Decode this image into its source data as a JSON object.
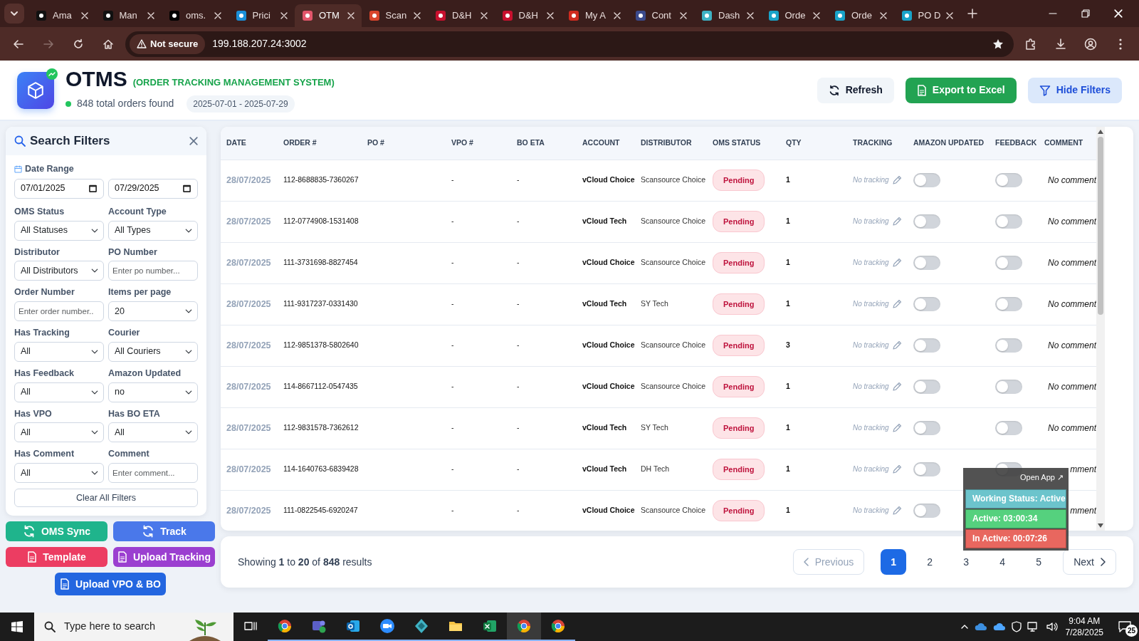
{
  "browser": {
    "tabs": [
      {
        "title": "Ama",
        "selected": false,
        "color": "#111111"
      },
      {
        "title": "Man",
        "selected": false,
        "color": "#111111"
      },
      {
        "title": "oms.",
        "selected": false,
        "color": "#000000"
      },
      {
        "title": "Prici",
        "selected": false,
        "color": "#1a8fd8"
      },
      {
        "title": "OTM",
        "selected": true,
        "color": "#e2566b"
      },
      {
        "title": "Scan",
        "selected": false,
        "color": "#d9452b"
      },
      {
        "title": "D&H",
        "selected": false,
        "color": "#c8102e"
      },
      {
        "title": "D&H",
        "selected": false,
        "color": "#c8102e"
      },
      {
        "title": "My A",
        "selected": false,
        "color": "#d02b1f"
      },
      {
        "title": "Cont",
        "selected": false,
        "color": "#3b4a8c"
      },
      {
        "title": "Dash",
        "selected": false,
        "color": "#3fb2c4"
      },
      {
        "title": "Orde",
        "selected": false,
        "color": "#19a3c9"
      },
      {
        "title": "Orde",
        "selected": false,
        "color": "#19a3c9"
      },
      {
        "title": "PO D",
        "selected": false,
        "color": "#19a3c9"
      }
    ],
    "security": "Not secure",
    "url": "199.188.207.24:3002"
  },
  "header": {
    "title": "OTMS",
    "subtitle": "(ORDER TRACKING MANAGEMENT SYSTEM)",
    "total": "848 total orders found",
    "date_range": "2025-07-01 - 2025-07-29",
    "buttons": [
      {
        "label": "Refresh",
        "kind": "refresh"
      },
      {
        "label": "Export to Excel",
        "kind": "export"
      },
      {
        "label": "Hide Filters",
        "kind": "filter"
      }
    ]
  },
  "filters": {
    "title": "Search Filters",
    "date_range": {
      "label": "Date Range",
      "from": "07/01/2025",
      "to": "07/29/2025"
    },
    "fields": [
      {
        "label": "OMS Status",
        "kind": "select",
        "value": "All Statuses"
      },
      {
        "label": "Account Type",
        "kind": "select",
        "value": "All Types"
      },
      {
        "label": "Distributor",
        "kind": "select",
        "value": "All Distributors"
      },
      {
        "label": "PO Number",
        "kind": "text",
        "placeholder": "Enter po number..."
      },
      {
        "label": "Order Number",
        "kind": "text",
        "placeholder": "Enter order number.."
      },
      {
        "label": "Items per page",
        "kind": "select",
        "value": "20"
      },
      {
        "label": "Has Tracking",
        "kind": "select",
        "value": "All"
      },
      {
        "label": "Courier",
        "kind": "select",
        "value": "All Couriers"
      },
      {
        "label": "Has Feedback",
        "kind": "select",
        "value": "All"
      },
      {
        "label": "Amazon Updated",
        "kind": "select",
        "value": "no"
      },
      {
        "label": "Has VPO",
        "kind": "select",
        "value": "All"
      },
      {
        "label": "Has BO ETA",
        "kind": "select",
        "value": "All"
      },
      {
        "label": "Has Comment",
        "kind": "select",
        "value": "All"
      },
      {
        "label": "Comment",
        "kind": "text",
        "placeholder": "Enter comment..."
      }
    ],
    "clear_button": "Clear All Filters"
  },
  "actions": [
    {
      "label": "OMS Sync",
      "kind": "sync",
      "color": "#1fb48c"
    },
    {
      "label": "Track",
      "kind": "sync",
      "color": "#4a78ea"
    },
    {
      "label": "Template",
      "kind": "file",
      "color": "#ec3d62"
    },
    {
      "label": "Upload Tracking",
      "kind": "file",
      "color": "#9b3fd0"
    },
    {
      "label": "Upload VPO & BO",
      "kind": "file",
      "color": "#2366e0"
    }
  ],
  "table": {
    "columns": [
      "DATE",
      "ORDER #",
      "PO #",
      "VPO #",
      "BO ETA",
      "ACCOUNT",
      "DISTRIBUTOR",
      "OMS STATUS",
      "QTY",
      "TRACKING",
      "AMAZON UPDATED",
      "FEEDBACK",
      "COMMENT"
    ],
    "rows": [
      {
        "date": "28/07/2025",
        "order": "112-8688835-7360267",
        "vpo": "-",
        "bo_eta": "-",
        "account": "vCloud Choice",
        "distributor": "Scansource Choice",
        "status": "Pending",
        "qty": "1",
        "tracking": "No tracking",
        "amazon_updated": false,
        "feedback": false,
        "comment": "No comment"
      },
      {
        "date": "28/07/2025",
        "order": "112-0774908-1531408",
        "vpo": "-",
        "bo_eta": "-",
        "account": "vCloud Tech",
        "distributor": "Scansource Choice",
        "status": "Pending",
        "qty": "1",
        "tracking": "No tracking",
        "amazon_updated": false,
        "feedback": false,
        "comment": "No comment"
      },
      {
        "date": "28/07/2025",
        "order": "111-3731698-8827454",
        "vpo": "-",
        "bo_eta": "-",
        "account": "vCloud Choice",
        "distributor": "Scansource Choice",
        "status": "Pending",
        "qty": "1",
        "tracking": "No tracking",
        "amazon_updated": false,
        "feedback": false,
        "comment": "No comment"
      },
      {
        "date": "28/07/2025",
        "order": "111-9317237-0331430",
        "vpo": "-",
        "bo_eta": "-",
        "account": "vCloud Tech",
        "distributor": "SY Tech",
        "status": "Pending",
        "qty": "1",
        "tracking": "No tracking",
        "amazon_updated": false,
        "feedback": false,
        "comment": "No comment"
      },
      {
        "date": "28/07/2025",
        "order": "112-9851378-5802640",
        "vpo": "-",
        "bo_eta": "-",
        "account": "vCloud Choice",
        "distributor": "Scansource Choice",
        "status": "Pending",
        "qty": "3",
        "tracking": "No tracking",
        "amazon_updated": false,
        "feedback": false,
        "comment": "No comment"
      },
      {
        "date": "28/07/2025",
        "order": "114-8667112-0547435",
        "vpo": "-",
        "bo_eta": "-",
        "account": "vCloud Choice",
        "distributor": "Scansource Choice",
        "status": "Pending",
        "qty": "1",
        "tracking": "No tracking",
        "amazon_updated": false,
        "feedback": false,
        "comment": "No comment"
      },
      {
        "date": "28/07/2025",
        "order": "112-9831578-7362612",
        "vpo": "-",
        "bo_eta": "-",
        "account": "vCloud Tech",
        "distributor": "SY Tech",
        "status": "Pending",
        "qty": "1",
        "tracking": "No tracking",
        "amazon_updated": false,
        "feedback": false,
        "comment": "No comment"
      },
      {
        "date": "28/07/2025",
        "order": "114-1640763-6839428",
        "vpo": "-",
        "bo_eta": "-",
        "account": "vCloud Tech",
        "distributor": "DH Tech",
        "status": "Pending",
        "qty": "1",
        "tracking": "No tracking",
        "amazon_updated": false,
        "feedback": false,
        "comment": "mment"
      },
      {
        "date": "28/07/2025",
        "order": "111-0822545-6920247",
        "vpo": "-",
        "bo_eta": "-",
        "account": "vCloud Choice",
        "distributor": "Scansource Choice",
        "status": "Pending",
        "qty": "1",
        "tracking": "No tracking",
        "amazon_updated": false,
        "comment": "mment"
      }
    ]
  },
  "pagination": {
    "summary": "Showing **1** to **20** of **848** results",
    "previous": {
      "label": "Previous",
      "disabled": true
    },
    "pages": [
      {
        "label": "1",
        "selected": true
      },
      {
        "label": "2",
        "selected": false
      },
      {
        "label": "3",
        "selected": false
      },
      {
        "label": "4",
        "selected": false
      },
      {
        "label": "5",
        "selected": false
      }
    ],
    "next": {
      "label": "Next",
      "disabled": false
    }
  },
  "tracker_widget": {
    "open_app": "Open App ↗",
    "working_status": "Working Status: Active",
    "active": "Active: 03:00:34",
    "inactive": "In Active: 00:07:26"
  },
  "taskbar": {
    "search_placeholder": "Type here to search",
    "time": "9:04 AM",
    "date": "7/28/2025",
    "notifications": "25"
  }
}
